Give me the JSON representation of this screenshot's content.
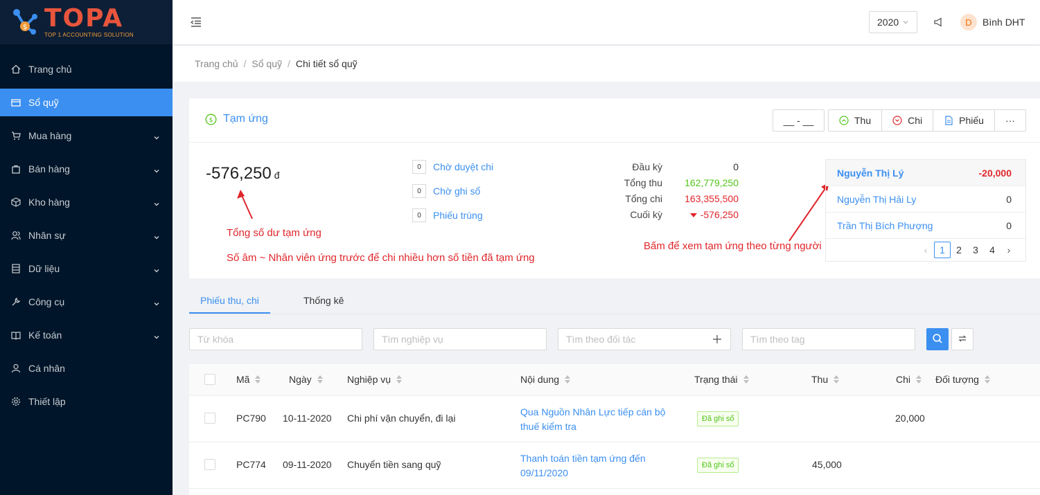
{
  "app": {
    "logo_text": "TOPA",
    "logo_tagline": "TOP 1 ACCOUNTING SOLUTION"
  },
  "sidebar": {
    "items": [
      {
        "label": "Trang chủ",
        "icon": "home-icon"
      },
      {
        "label": "Sổ quỹ",
        "icon": "wallet-icon",
        "active": true
      },
      {
        "label": "Mua hàng",
        "icon": "cart-icon"
      },
      {
        "label": "Bán hàng",
        "icon": "bag-icon"
      },
      {
        "label": "Kho hàng",
        "icon": "box-icon"
      },
      {
        "label": "Nhân sự",
        "icon": "users-icon"
      },
      {
        "label": "Dữ liệu",
        "icon": "database-icon"
      },
      {
        "label": "Công cụ",
        "icon": "tool-icon"
      },
      {
        "label": "Kế toán",
        "icon": "book-icon"
      },
      {
        "label": "Cá nhân",
        "icon": "user-icon"
      },
      {
        "label": "Thiết lập",
        "icon": "gear-icon"
      }
    ]
  },
  "header": {
    "year": "2020",
    "user_initial": "D",
    "user_name": "Bình DHT"
  },
  "breadcrumb": [
    "Trang chủ",
    "Sổ quỹ",
    "Chi tiết sổ quỹ"
  ],
  "card": {
    "title": "Tạm ứng",
    "date_placeholder": "__ - __",
    "buttons": {
      "thu": "Thu",
      "chi": "Chi",
      "phieu": "Phiếu",
      "more": "···"
    },
    "balance": "-576,250",
    "currency": "đ",
    "annotations": {
      "note1": "Tổng số dư tạm ứng",
      "note2": "Số âm ~ Nhân viên ứng trước để chi nhiều hơn số tiền đã tạm ứng",
      "note3": "Bấm để xem tạm ứng theo từng người"
    },
    "statuses": [
      {
        "count": "0",
        "label": "Chờ duyệt chi"
      },
      {
        "count": "0",
        "label": "Chờ ghi sổ"
      },
      {
        "count": "0",
        "label": "Phiếu trùng"
      }
    ],
    "summary": [
      {
        "label": "Đầu kỳ",
        "value": "0"
      },
      {
        "label": "Tổng thu",
        "value": "162,779,250"
      },
      {
        "label": "Tổng chi",
        "value": "163,355,500"
      },
      {
        "label": "Cuối kỳ",
        "value": "-576,250"
      }
    ],
    "people": [
      {
        "name": "Nguyễn Thị Lý",
        "amount": "-20,000"
      },
      {
        "name": "Nguyễn Thị Hải Ly",
        "amount": "0"
      },
      {
        "name": "Trần Thị Bích Phượng",
        "amount": "0"
      }
    ],
    "pager": {
      "pages": [
        "1",
        "2",
        "3",
        "4"
      ],
      "current": "1",
      "prev": "‹",
      "next": "›"
    }
  },
  "tabs": [
    "Phiếu thu, chi",
    "Thống kê"
  ],
  "filters": {
    "keyword": "Từ khóa",
    "operation": "Tìm nghiệp vụ",
    "partner": "Tìm theo đối tác",
    "tag": "Tìm theo tag"
  },
  "table": {
    "columns": [
      "Mã",
      "Ngày",
      "Nghiệp vụ",
      "Nội dung",
      "Trạng thái",
      "Thu",
      "Chi",
      "Đối tượng"
    ],
    "rows": [
      {
        "code": "PC790",
        "date": "10-11-2020",
        "operation": "Chi phí vận chuyển, đi lại",
        "content": "Qua Nguồn Nhân Lực tiếp cán bộ thuế kiểm tra",
        "status": "Đã ghi sổ",
        "thu": "",
        "chi": "20,000",
        "target": ""
      },
      {
        "code": "PC774",
        "date": "09-11-2020",
        "operation": "Chuyển tiền sang quỹ",
        "content": "Thanh toán tiền tạm ứng đến 09/11/2020",
        "status": "Đã ghi sổ",
        "thu": "45,000",
        "chi": "",
        "target": ""
      }
    ]
  },
  "colors": {
    "primary": "#3b8ff0",
    "sidebar_bg": "#001529",
    "danger": "#e0262b",
    "success": "#52c41a"
  }
}
